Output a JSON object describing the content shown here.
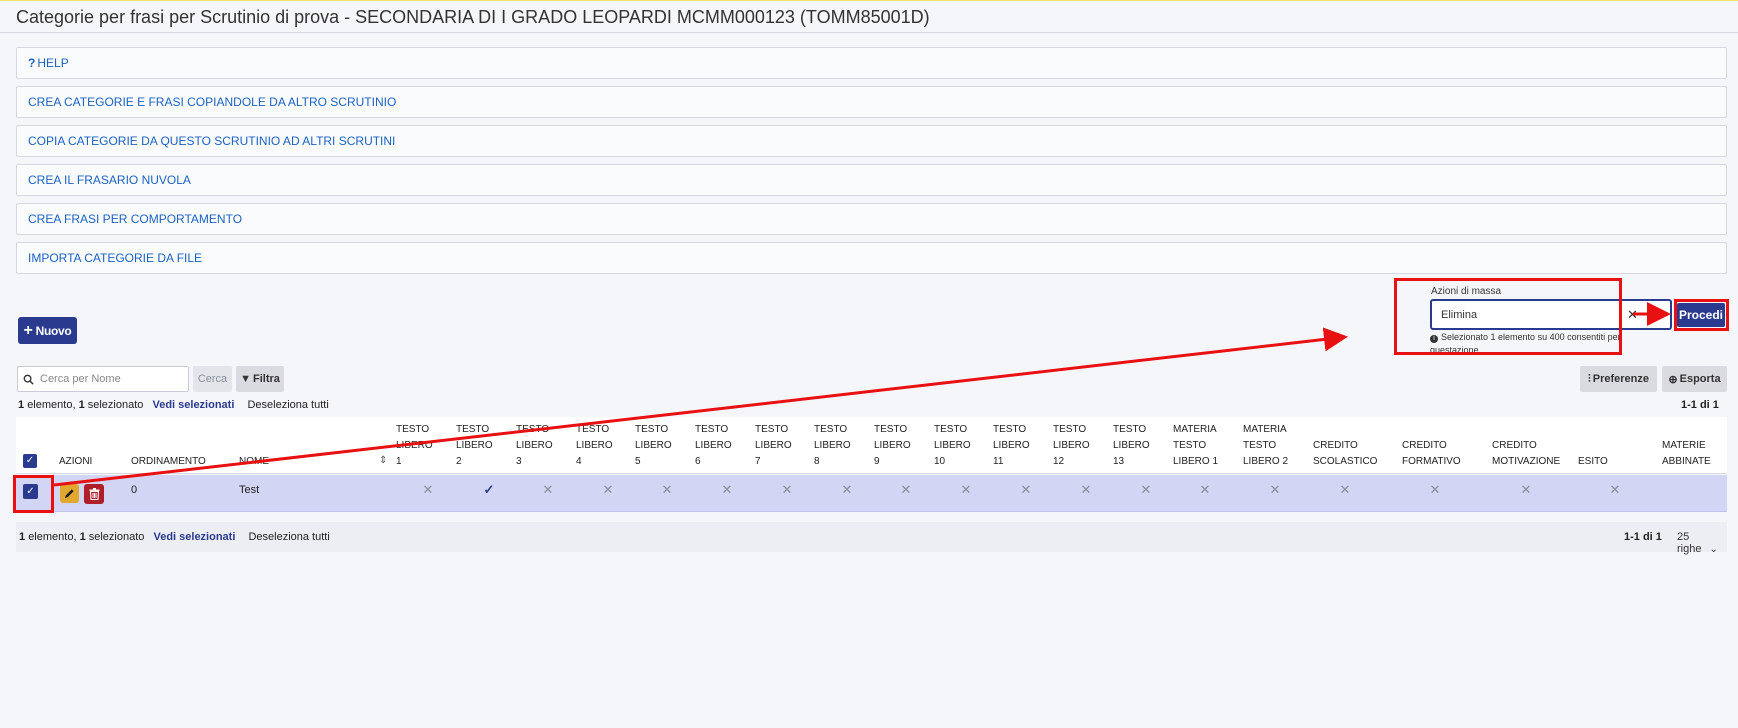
{
  "page_title": "Categorie per frasi per Scrutinio di prova - SECONDARIA DI I GRADO LEOPARDI MCMM000123 (TOMM85001D)",
  "accordions": [
    {
      "label": "HELP",
      "prefix": "?"
    },
    {
      "label": "CREA CATEGORIE E FRASI COPIANDOLE DA ALTRO SCRUTINIO"
    },
    {
      "label": "COPIA CATEGORIE DA QUESTO SCRUTINIO AD ALTRI SCRUTINI"
    },
    {
      "label": "CREA IL FRASARIO NUVOLA"
    },
    {
      "label": "CREA FRASI PER COMPORTAMENTO"
    },
    {
      "label": "IMPORTA CATEGORIE DA FILE"
    }
  ],
  "new_button": "Nuovo",
  "mass_actions": {
    "label": "Azioni di massa",
    "value": "Elimina",
    "info": "Selezionato 1 elemento su 400 consentiti per questazione",
    "submit": "Procedi"
  },
  "search": {
    "placeholder": "Cerca per Nome",
    "button": "Cerca",
    "filter": "Filtra"
  },
  "toolbar": {
    "preferences": "Preferenze",
    "export": "Esporta"
  },
  "selection": {
    "count": "1",
    "elements": "elemento,",
    "selected_count": "1",
    "selected": "selezionato",
    "show_selected": "Vedi selezionati",
    "deselect_all": "Deseleziona tutti"
  },
  "pagination": {
    "range": "1-1 di 1",
    "rows": "25 righe"
  },
  "table": {
    "columns": [
      {
        "key": "azioni",
        "lines": [
          "AZIONI"
        ]
      },
      {
        "key": "ordinamento",
        "lines": [
          "ORDINAMENTO"
        ]
      },
      {
        "key": "nome",
        "lines": [
          "NOME"
        ]
      },
      {
        "key": "tl1",
        "lines": [
          "TESTO",
          "LIBERO",
          "1"
        ]
      },
      {
        "key": "tl2",
        "lines": [
          "TESTO",
          "LIBERO",
          "2"
        ]
      },
      {
        "key": "tl3",
        "lines": [
          "TESTO",
          "LIBERO",
          "3"
        ]
      },
      {
        "key": "tl4",
        "lines": [
          "TESTO",
          "LIBERO",
          "4"
        ]
      },
      {
        "key": "tl5",
        "lines": [
          "TESTO",
          "LIBERO",
          "5"
        ]
      },
      {
        "key": "tl6",
        "lines": [
          "TESTO",
          "LIBERO",
          "6"
        ]
      },
      {
        "key": "tl7",
        "lines": [
          "TESTO",
          "LIBERO",
          "7"
        ]
      },
      {
        "key": "tl8",
        "lines": [
          "TESTO",
          "LIBERO",
          "8"
        ]
      },
      {
        "key": "tl9",
        "lines": [
          "TESTO",
          "LIBERO",
          "9"
        ]
      },
      {
        "key": "tl10",
        "lines": [
          "TESTO",
          "LIBERO",
          "10"
        ]
      },
      {
        "key": "tl11",
        "lines": [
          "TESTO",
          "LIBERO",
          "11"
        ]
      },
      {
        "key": "tl12",
        "lines": [
          "TESTO",
          "LIBERO",
          "12"
        ]
      },
      {
        "key": "tl13",
        "lines": [
          "TESTO",
          "LIBERO",
          "13"
        ]
      },
      {
        "key": "mtl1",
        "lines": [
          "MATERIA",
          "TESTO",
          "LIBERO 1"
        ]
      },
      {
        "key": "mtl2",
        "lines": [
          "MATERIA",
          "TESTO",
          "LIBERO 2"
        ]
      },
      {
        "key": "credito_scolastico",
        "lines": [
          "CREDITO",
          "SCOLASTICO"
        ]
      },
      {
        "key": "credito_formativo",
        "lines": [
          "CREDITO",
          "FORMATIVO"
        ]
      },
      {
        "key": "credito_motivazione",
        "lines": [
          "CREDITO",
          "MOTIVAZIONE"
        ]
      },
      {
        "key": "esito",
        "lines": [
          "ESITO"
        ]
      },
      {
        "key": "materie_abbinate",
        "lines": [
          "MATERIE",
          "ABBINATE"
        ]
      }
    ],
    "rows": [
      {
        "ordinamento": "0",
        "nome": "Test",
        "flags": [
          false,
          true,
          false,
          false,
          false,
          false,
          false,
          false,
          false,
          false,
          false,
          false,
          false,
          false,
          false,
          false,
          false,
          false,
          false
        ],
        "flag_on_symbol": "✓",
        "flag_off_symbol": "✕"
      }
    ]
  },
  "colors": {
    "primary": "#2a3a8f",
    "highlight_red": "#e81010",
    "selected_row": "#d2d5f3",
    "link": "#1b62c4"
  }
}
